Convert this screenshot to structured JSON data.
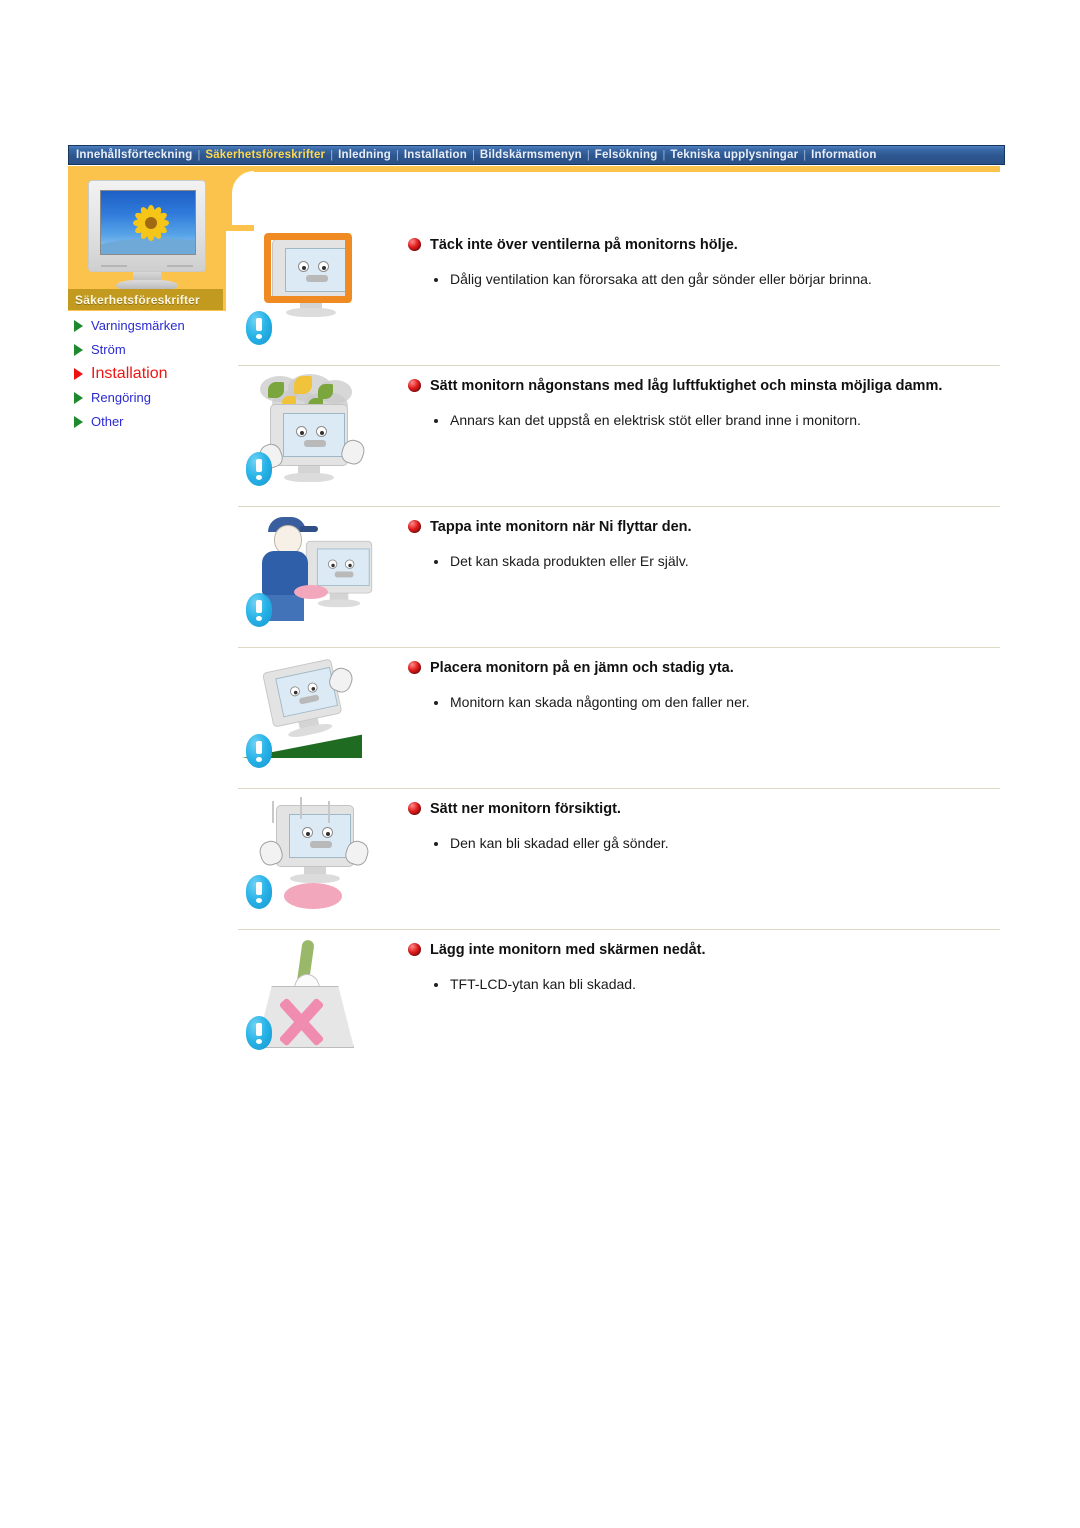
{
  "topnav": {
    "items": [
      {
        "label": "Innehållsförteckning",
        "active": false
      },
      {
        "label": "Säkerhetsföreskrifter",
        "active": true
      },
      {
        "label": "Inledning",
        "active": false
      },
      {
        "label": "Installation",
        "active": false
      },
      {
        "label": "Bildskärmsmenyn",
        "active": false
      },
      {
        "label": "Felsökning",
        "active": false
      },
      {
        "label": "Tekniska upplysningar",
        "active": false
      },
      {
        "label": "Information",
        "active": false
      }
    ],
    "separator": "|"
  },
  "sidebar": {
    "panel_label": "Säkerhetsföreskrifter",
    "items": [
      {
        "label": "Varningsmärken",
        "active": false
      },
      {
        "label": "Ström",
        "active": false
      },
      {
        "label": "Installation",
        "active": true
      },
      {
        "label": "Rengöring",
        "active": false
      },
      {
        "label": "Other",
        "active": false
      }
    ]
  },
  "colors": {
    "panel_orange": "#fbc34b",
    "panel_label_bg": "#c19a1f",
    "nav_bg": "#2d568f",
    "nav_active_text": "#ffd84d",
    "link_blue": "#2a2ad0",
    "active_red": "#f01616",
    "arrow_green": "#1e8a2e",
    "divider": "#ddd8c4"
  },
  "sections": [
    {
      "heading": "Täck inte över ventilerna på monitorns hölje.",
      "bullets": [
        "Dålig ventilation kan förorsaka att den går sönder eller börjar brinna."
      ],
      "illustration": "monitor-wrapped-in-tiger-blanket"
    },
    {
      "heading": "Sätt monitorn någonstans med låg luftfuktighet och minsta möjliga damm.",
      "bullets": [
        "Annars kan det uppstå en elektrisk stöt eller brand inne i monitorn."
      ],
      "illustration": "monitor-with-dust-cloud"
    },
    {
      "heading": "Tappa inte monitorn när Ni flyttar den.",
      "bullets": [
        "Det kan skada produkten eller Er själv."
      ],
      "illustration": "person-carrying-monitor"
    },
    {
      "heading": "Placera monitorn på en jämn och stadig yta.",
      "bullets": [
        "Monitorn kan skada någonting om den faller ner."
      ],
      "illustration": "monitor-on-slope"
    },
    {
      "heading": "Sätt ner monitorn försiktigt.",
      "bullets": [
        "Den kan bli skadad eller gå sönder."
      ],
      "illustration": "monitor-dropped-hard"
    },
    {
      "heading": "Lägg inte monitorn med skärmen nedåt.",
      "bullets": [
        "TFT-LCD-ytan kan bli skadad."
      ],
      "illustration": "monitor-face-down-crossed-out"
    }
  ]
}
